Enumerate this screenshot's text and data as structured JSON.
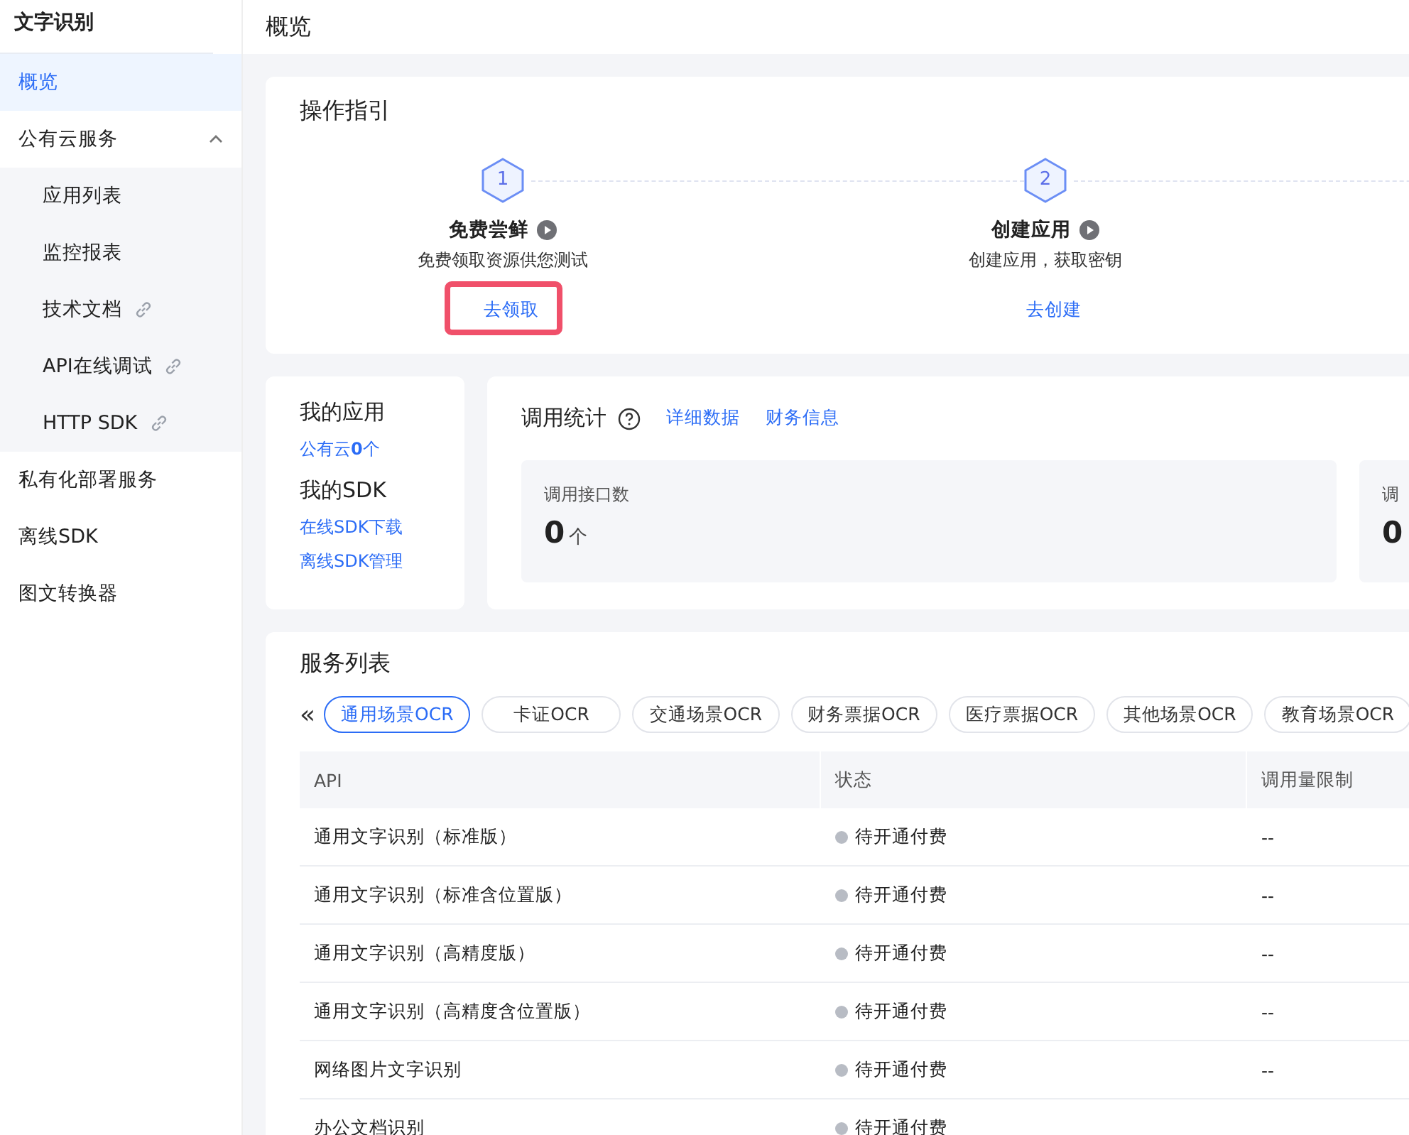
{
  "sidebar": {
    "title": "文字识别",
    "items": [
      {
        "label": "概览",
        "selected": true
      },
      {
        "label": "公有云服务",
        "selected": false,
        "expanded": true,
        "children": [
          {
            "label": "应用列表",
            "selected": false,
            "external": false
          },
          {
            "label": "监控报表",
            "selected": false,
            "external": false
          },
          {
            "label": "技术文档",
            "selected": false,
            "external": true
          },
          {
            "label": "API在线调试",
            "selected": false,
            "external": true
          },
          {
            "label": "HTTP SDK",
            "selected": false,
            "external": true
          }
        ]
      },
      {
        "label": "私有化部署服务",
        "selected": false
      },
      {
        "label": "离线SDK",
        "selected": false
      },
      {
        "label": "图文转换器",
        "selected": false
      }
    ]
  },
  "page_title": "概览",
  "guide": {
    "title": "操作指引",
    "steps": [
      {
        "number": "1",
        "title": "免费尝鲜",
        "description": "免费领取资源供您测试",
        "action": "去领取",
        "highlighted": true
      },
      {
        "number": "2",
        "title": "创建应用",
        "description": "创建应用，获取密钥",
        "action": "去创建",
        "highlighted": false
      }
    ]
  },
  "my_apps": {
    "title": "我的应用",
    "public_cloud": "公有云**0**个",
    "sdk_title": "我的SDK",
    "sdk_links": [
      "在线SDK下载",
      "离线SDK管理"
    ]
  },
  "call_stats": {
    "title": "调用统计",
    "links": [
      "详细数据",
      "财务信息"
    ],
    "cards": [
      {
        "label": "调用接口数",
        "value": "0",
        "unit": "个"
      },
      {
        "label": "调",
        "value": "0"
      }
    ]
  },
  "service_list": {
    "title": "服务列表",
    "scroll_left": "«",
    "tabs": [
      {
        "label": "通用场景OCR",
        "selected": true
      },
      {
        "label": "卡证OCR",
        "selected": false
      },
      {
        "label": "交通场景OCR",
        "selected": false
      },
      {
        "label": "财务票据OCR",
        "selected": false
      },
      {
        "label": "医疗票据OCR",
        "selected": false
      },
      {
        "label": "其他场景OCR",
        "selected": false
      },
      {
        "label": "教育场景OCR",
        "selected": false
      }
    ],
    "columns": [
      "API",
      "状态",
      "调用量限制"
    ],
    "rows": [
      {
        "api": "通用文字识别（标准版）",
        "status": "待开通付费",
        "limit": "--"
      },
      {
        "api": "通用文字识别（标准含位置版）",
        "status": "待开通付费",
        "limit": "--"
      },
      {
        "api": "通用文字识别（高精度版）",
        "status": "待开通付费",
        "limit": "--"
      },
      {
        "api": "通用文字识别（高精度含位置版）",
        "status": "待开通付费",
        "limit": "--"
      },
      {
        "api": "网络图片文字识别",
        "status": "待开通付费",
        "limit": "--"
      },
      {
        "api": "办公文档识别",
        "status": "待开通付费"
      }
    ]
  }
}
